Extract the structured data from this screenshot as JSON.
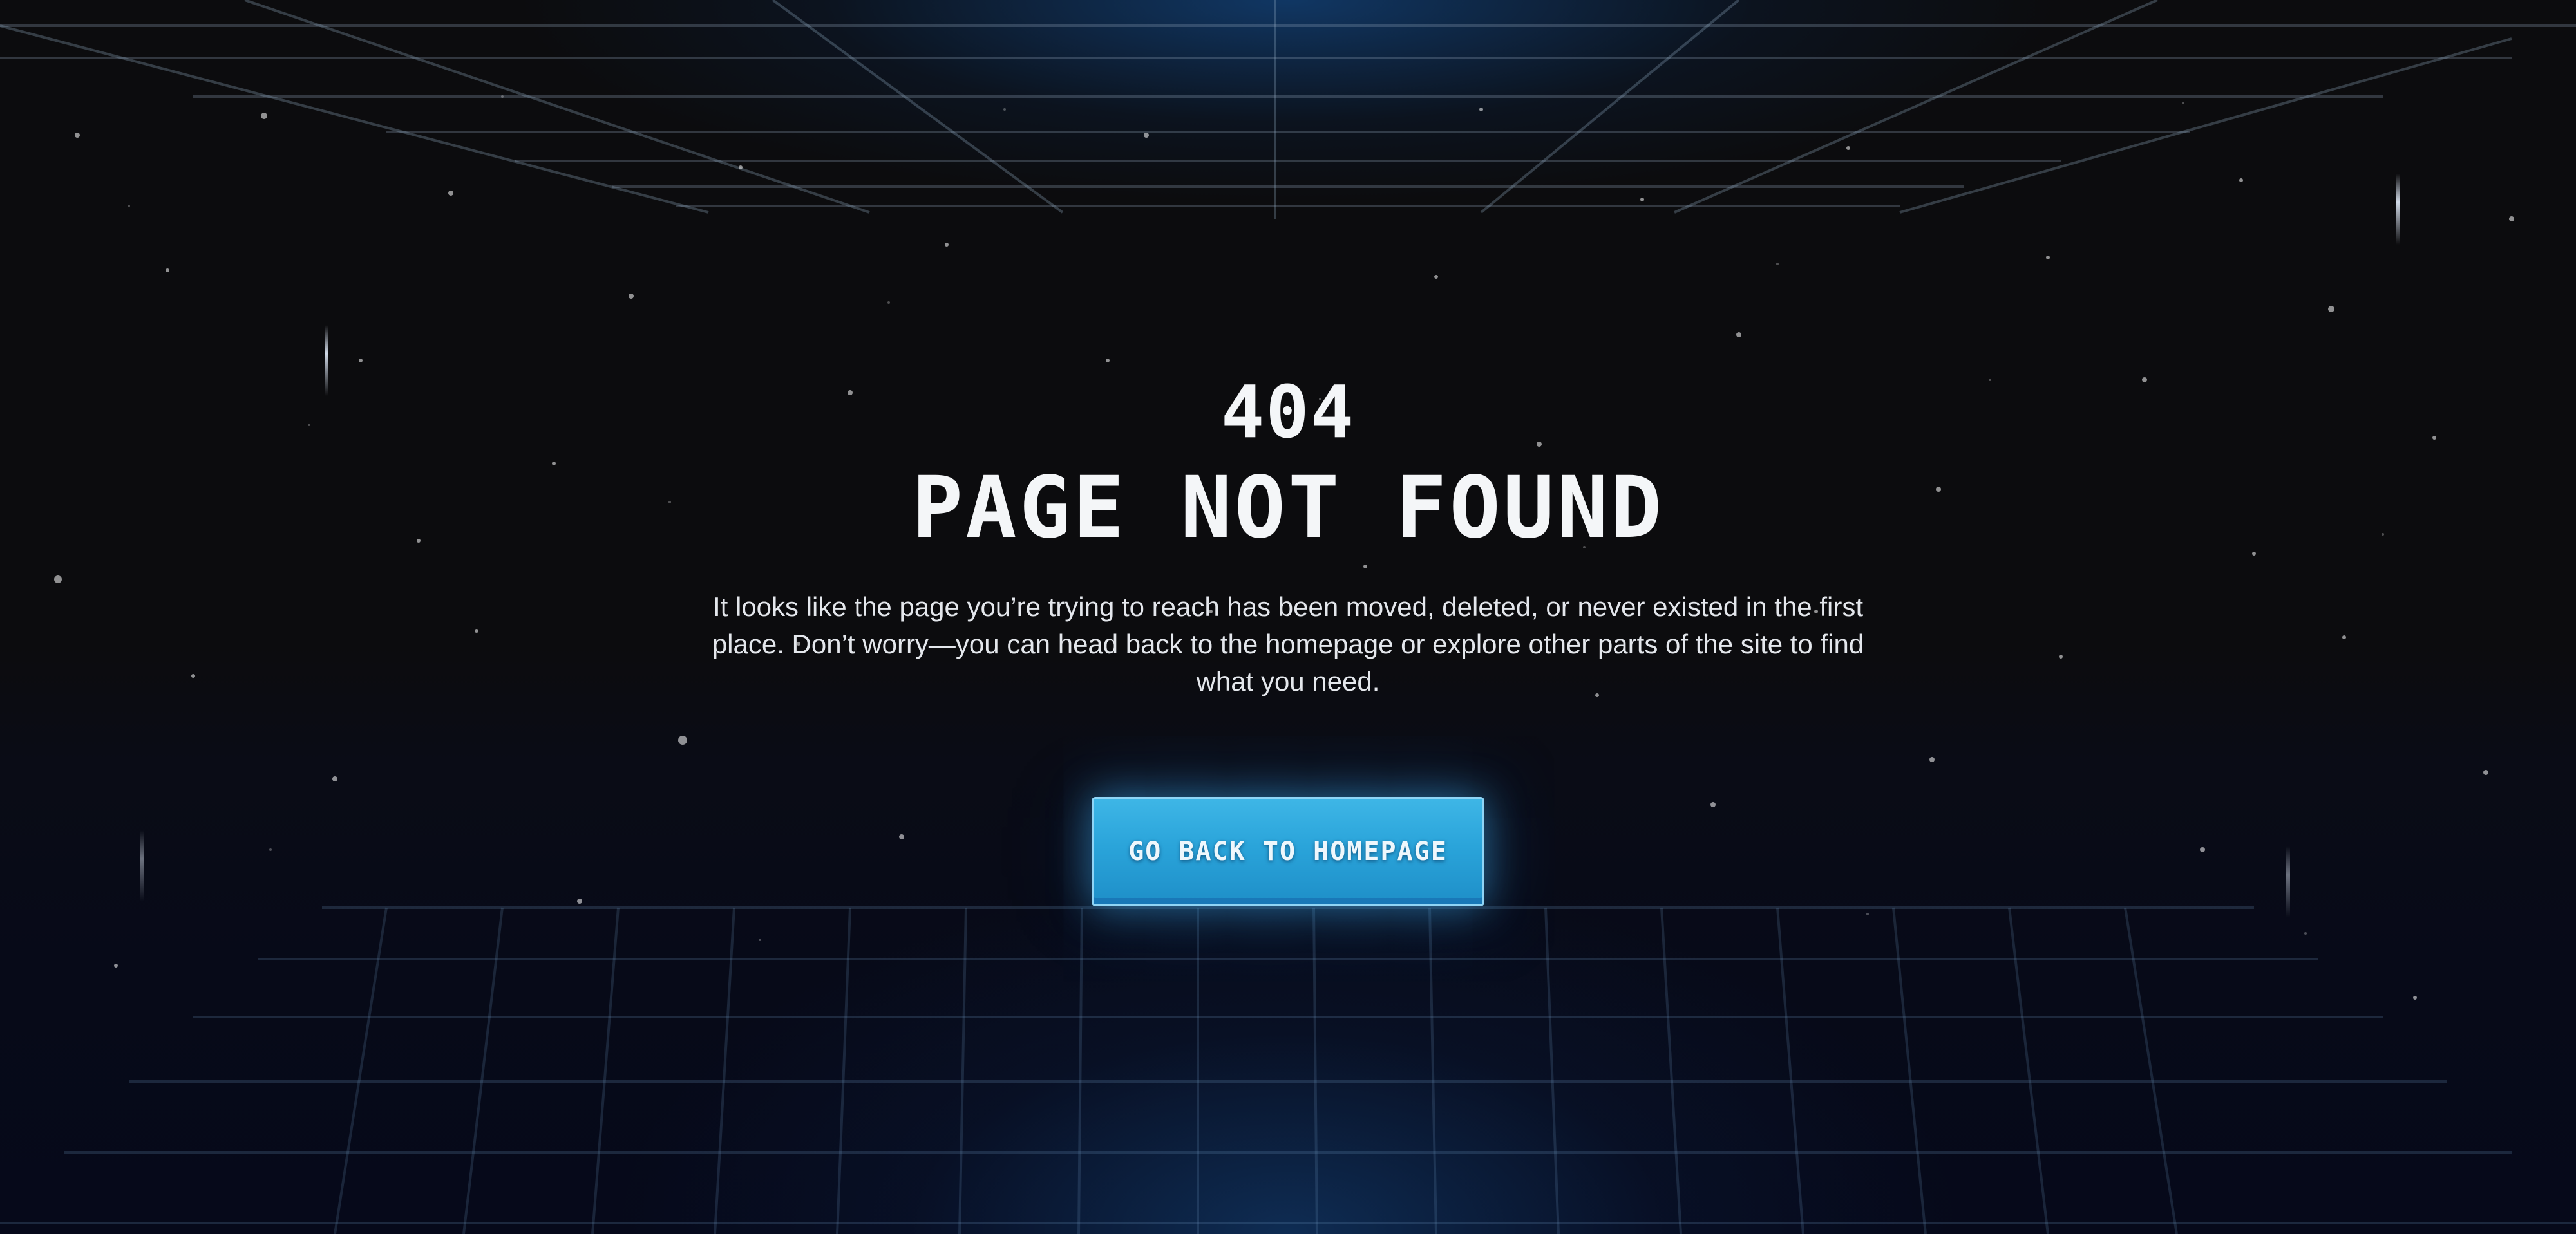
{
  "error": {
    "code": "404",
    "headline": "PAGE NOT FOUND",
    "message": "It looks like the page you’re trying to reach has been moved, deleted, or never existed in the first place. Don’t worry—you can head back to the homepage or explore other parts of the site to find what you need."
  },
  "cta": {
    "label": "GO BACK TO HOMEPAGE"
  },
  "colors": {
    "background": "#0c0c0e",
    "accent": "#2aa4da",
    "text": "#f4f6f8"
  }
}
